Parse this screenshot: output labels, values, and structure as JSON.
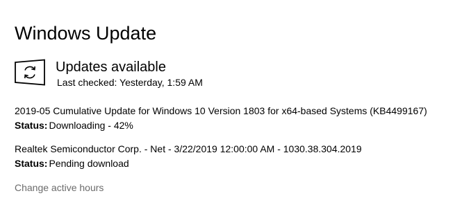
{
  "page": {
    "title": "Windows Update"
  },
  "status": {
    "icon": "sync-icon",
    "heading": "Updates available",
    "last_checked": "Last checked: Yesterday, 1:59 AM"
  },
  "updates": [
    {
      "name": "2019-05 Cumulative Update for Windows 10 Version 1803 for x64-based Systems (KB4499167)",
      "status_label": "Status:",
      "status_value": "Downloading - 42%",
      "progress_percent": 42
    },
    {
      "name": "Realtek Semiconductor Corp. - Net - 3/22/2019 12:00:00 AM - 1030.38.304.2019",
      "status_label": "Status:",
      "status_value": "Pending download"
    }
  ],
  "links": {
    "change_active_hours": "Change active hours"
  },
  "colors": {
    "text": "#000000",
    "link_gray": "#6b6b6b",
    "background": "#ffffff"
  }
}
